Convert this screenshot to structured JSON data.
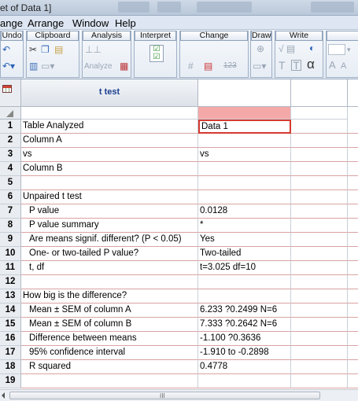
{
  "window": {
    "title": "et of Data 1]"
  },
  "menu": [
    "ange",
    "Arrange",
    "Window",
    "Help"
  ],
  "ribbon": {
    "groups": [
      {
        "label": "Undo"
      },
      {
        "label": "Clipboard"
      },
      {
        "label": "Analysis",
        "analyze_label": "Analyze"
      },
      {
        "label": "Interpret"
      },
      {
        "label": "Change",
        "number_label": "123"
      },
      {
        "label": "Draw"
      },
      {
        "label": "Write",
        "alpha": "α",
        "tt1": "T",
        "tt2": "T"
      }
    ]
  },
  "sheet": {
    "column_title": "t test",
    "rows": [
      {
        "n": "1",
        "label": "Table Analyzed",
        "value": "Data 1",
        "indent": false
      },
      {
        "n": "2",
        "label": "Column A",
        "value": "",
        "indent": false
      },
      {
        "n": "3",
        "label": "vs",
        "value": "vs",
        "indent": false
      },
      {
        "n": "4",
        "label": "Column B",
        "value": "",
        "indent": false
      },
      {
        "n": "5",
        "label": "",
        "value": "",
        "indent": false
      },
      {
        "n": "6",
        "label": "Unpaired t test",
        "value": "",
        "indent": false
      },
      {
        "n": "7",
        "label": "P value",
        "value": "0.0128",
        "indent": true
      },
      {
        "n": "8",
        "label": "P value summary",
        "value": "*",
        "indent": true
      },
      {
        "n": "9",
        "label": "Are means signif. different? (P < 0.05)",
        "value": "Yes",
        "indent": true
      },
      {
        "n": "10",
        "label": "One- or two-tailed P value?",
        "value": "Two-tailed",
        "indent": true
      },
      {
        "n": "11",
        "label": "t, df",
        "value": "t=3.025 df=10",
        "indent": true
      },
      {
        "n": "12",
        "label": "",
        "value": "",
        "indent": false
      },
      {
        "n": "13",
        "label": "How big is the difference?",
        "value": "",
        "indent": false
      },
      {
        "n": "14",
        "label": "Mean ± SEM of column A",
        "value": "6.233 ?0.2499 N=6",
        "indent": true
      },
      {
        "n": "15",
        "label": "Mean ± SEM of column B",
        "value": "7.333 ?0.2642 N=6",
        "indent": true
      },
      {
        "n": "16",
        "label": "Difference between means",
        "value": "-1.100 ?0.3636",
        "indent": true
      },
      {
        "n": "17",
        "label": "95% confidence interval",
        "value": "-1.910 to -0.2898",
        "indent": true
      },
      {
        "n": "18",
        "label": "R squared",
        "value": "0.4778",
        "indent": true
      },
      {
        "n": "19",
        "label": "",
        "value": "",
        "indent": false
      }
    ]
  },
  "scrollbar": {
    "grip": "III"
  }
}
